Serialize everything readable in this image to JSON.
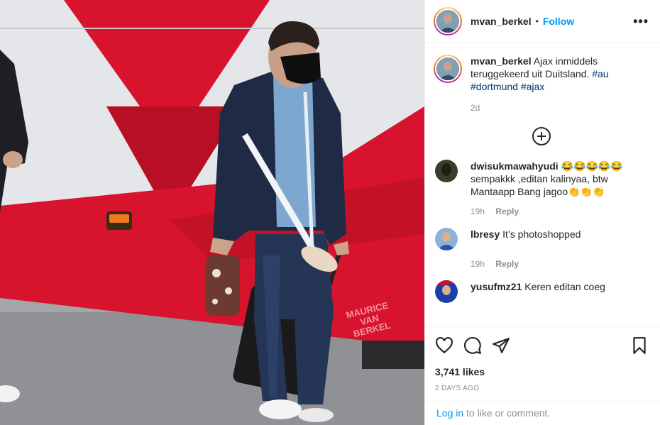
{
  "post": {
    "author": "mvan_berkel",
    "separator": "•",
    "follow_label": "Follow",
    "more_label": "•••",
    "caption": {
      "text": "Ajax inmiddels teruggekeerd uit Duitsland.",
      "hashtags": [
        "#au",
        "#dortmund",
        "#ajax"
      ],
      "time": "2d"
    },
    "photo_watermark": "MAURICE VAN BERKEL"
  },
  "comments": [
    {
      "username": "dwisukmawahyudi",
      "text": "😂😂😂😂😂sempakkk ,editan kalinyaa, btw Mantaapp Bang jagoo👏👏👏",
      "time": "19h",
      "reply_label": "Reply"
    },
    {
      "username": "lbresy",
      "text": "It’s photoshopped",
      "time": "19h",
      "reply_label": "Reply"
    },
    {
      "username": "yusufmz21",
      "text": "Keren editan coeg",
      "time": "",
      "reply_label": ""
    }
  ],
  "actions": {
    "icons": [
      "heart-icon",
      "comment-icon",
      "share-icon",
      "bookmark-icon"
    ],
    "likes": "3,741 likes",
    "date": "2 DAYS AGO"
  },
  "footer": {
    "login_link": "Log in",
    "login_text": " to like or comment."
  },
  "colors": {
    "link_blue": "#0095f6",
    "hashtag": "#00376b",
    "muted": "#8e8e8e",
    "bus_red": "#d8132d"
  }
}
